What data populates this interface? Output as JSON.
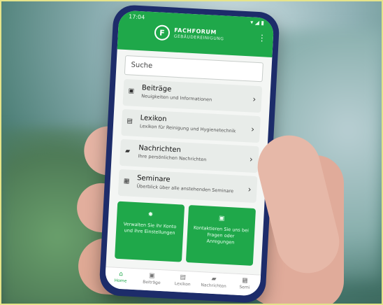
{
  "app": {
    "logo_name": "FACHFORUM",
    "logo_sub": "GEBÄUDEREINIGUNG"
  },
  "status": {
    "time": "17:04"
  },
  "search": {
    "placeholder": "Suche"
  },
  "menu": [
    {
      "title": "Beiträge",
      "subtitle": "Neuigkeiten und Informationen",
      "icon": "article-icon"
    },
    {
      "title": "Lexikon",
      "subtitle": "Lexikon für Reinigung und Hygienetechnik",
      "icon": "book-icon"
    },
    {
      "title": "Nachrichten",
      "subtitle": "Ihre persönlichen Nachrichten",
      "icon": "message-icon"
    },
    {
      "title": "Seminare",
      "subtitle": "Überblick über alle anstehenden Seminare",
      "icon": "calendar-icon"
    }
  ],
  "tiles": [
    {
      "text": "Verwalten Sie ihr Konto und ihre Einstellungen",
      "icon": "gear-icon"
    },
    {
      "text": "Kontaktieren Sie uns bei Fragen oder Anregungen",
      "icon": "contact-icon"
    }
  ],
  "bottom_nav": [
    {
      "label": "Home",
      "icon": "home-icon",
      "active": true
    },
    {
      "label": "Beiträge",
      "icon": "article-icon",
      "active": false
    },
    {
      "label": "Lexikon",
      "icon": "book-icon",
      "active": false
    },
    {
      "label": "Nachrichten",
      "icon": "message-icon",
      "active": false
    },
    {
      "label": "Semi",
      "icon": "calendar-icon",
      "active": false
    }
  ],
  "colors": {
    "brand_green": "#1fa84a",
    "phone_frame": "#1d2c6a"
  }
}
